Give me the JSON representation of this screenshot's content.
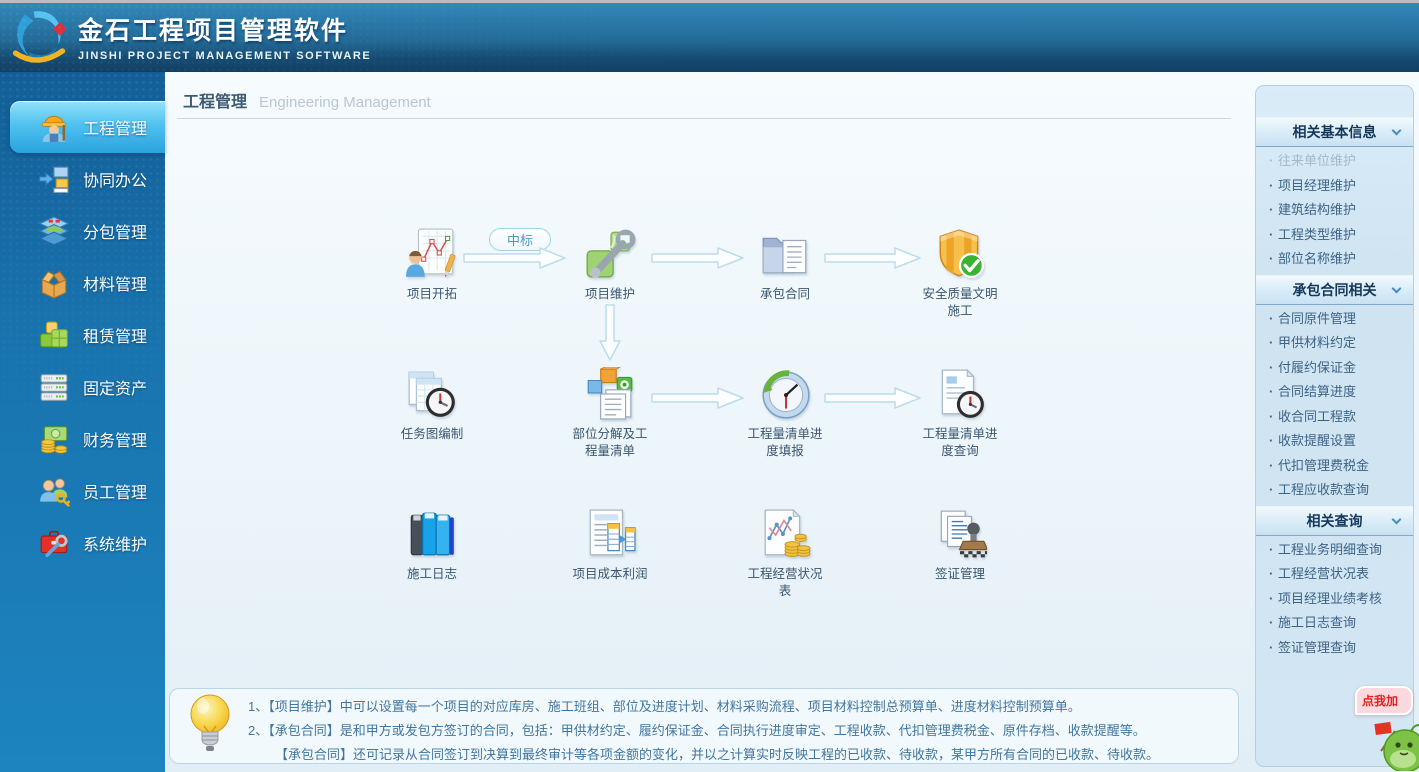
{
  "header": {
    "title": "金石工程项目管理软件",
    "subtitle": "JINSHI PROJECT MANAGEMENT SOFTWARE"
  },
  "sidebar": {
    "items": [
      {
        "label": "工程管理",
        "icon": "worker-icon",
        "active": true
      },
      {
        "label": "协同办公",
        "icon": "collaboration-icon",
        "active": false
      },
      {
        "label": "分包管理",
        "icon": "layers-icon",
        "active": false
      },
      {
        "label": "材料管理",
        "icon": "material-box-icon",
        "active": false
      },
      {
        "label": "租赁管理",
        "icon": "lease-blocks-icon",
        "active": false
      },
      {
        "label": "固定资产",
        "icon": "assets-server-icon",
        "active": false
      },
      {
        "label": "财务管理",
        "icon": "finance-money-icon",
        "active": false
      },
      {
        "label": "员工管理",
        "icon": "employee-key-icon",
        "active": false
      },
      {
        "label": "系统维护",
        "icon": "system-toolbox-icon",
        "active": false
      }
    ]
  },
  "main": {
    "title_zh": "工程管理",
    "title_en": "Engineering Management",
    "flow": {
      "bid_badge": "中标",
      "nodes": [
        {
          "label": "项目开拓",
          "icon": "person-chart-icon"
        },
        {
          "label": "项目维护",
          "icon": "blocks-wrench-icon"
        },
        {
          "label": "承包合同",
          "icon": "folder-document-icon"
        },
        {
          "label": "安全质量文明施工",
          "icon": "shield-check-icon"
        },
        {
          "label": "任务图编制",
          "icon": "sheet-clock-icon"
        },
        {
          "label": "部位分解及工程量清单",
          "icon": "cubes-papers-icon"
        },
        {
          "label": "工程量清单进度填报",
          "icon": "compass-clock-icon"
        },
        {
          "label": "工程量清单进度查询",
          "icon": "document-clock-icon"
        },
        {
          "label": "施工日志",
          "icon": "books-icon"
        },
        {
          "label": "项目成本利润",
          "icon": "document-tables-icon"
        },
        {
          "label": "工程经营状况表",
          "icon": "chart-coins-icon"
        },
        {
          "label": "签证管理",
          "icon": "stamp-documents-icon"
        }
      ]
    },
    "tips": {
      "line1": "1、【项目维护】中可以设置每一个项目的对应库房、施工班组、部位及进度计划、材料采购流程、项目材料控制总预算单、进度材料控制预算单。",
      "line2": "2、【承包合同】是和甲方或发包方签订的合同，包括：甲供材约定、履约保证金、合同执行进度审定、工程收款、代扣管理费税金、原件存档、收款提醒等。",
      "line3": "【承包合同】还可记录从合同签订到决算到最终审计等各项金额的变化，并以之计算实时反映工程的已收款、待收款，某甲方所有合同的已收款、待收款。"
    }
  },
  "right_panel": {
    "sections": [
      {
        "title": "相关基本信息",
        "links": [
          {
            "label": "往来单位维护",
            "dim": true
          },
          {
            "label": "项目经理维护",
            "dim": false
          },
          {
            "label": "建筑结构维护",
            "dim": false
          },
          {
            "label": "工程类型维护",
            "dim": false
          },
          {
            "label": "部位名称维护",
            "dim": false
          }
        ]
      },
      {
        "title": "承包合同相关",
        "links": [
          {
            "label": "合同原件管理",
            "dim": false
          },
          {
            "label": "甲供材料约定",
            "dim": false
          },
          {
            "label": "付履约保证金",
            "dim": false
          },
          {
            "label": "合同结算进度",
            "dim": false
          },
          {
            "label": "收合同工程款",
            "dim": false
          },
          {
            "label": "收款提醒设置",
            "dim": false
          },
          {
            "label": "代扣管理费税金",
            "dim": false
          },
          {
            "label": "工程应收款查询",
            "dim": false
          }
        ]
      },
      {
        "title": "相关查询",
        "links": [
          {
            "label": "工程业务明细查询",
            "dim": false
          },
          {
            "label": "工程经营状况表",
            "dim": false
          },
          {
            "label": "项目经理业绩考核",
            "dim": false
          },
          {
            "label": "施工日志查询",
            "dim": false
          },
          {
            "label": "签证管理查询",
            "dim": false
          }
        ]
      }
    ]
  },
  "mascot": {
    "bubble_text": "点我加",
    "accent_color": "#e02222"
  },
  "colors": {
    "header_blue": "#236a97",
    "sidebar_blue": "#1872ac",
    "active_item_blue": "#50c2ef",
    "panel_blue": "#cfe3f1",
    "link_text": "#3c6386",
    "tip_text": "#4076a0"
  }
}
